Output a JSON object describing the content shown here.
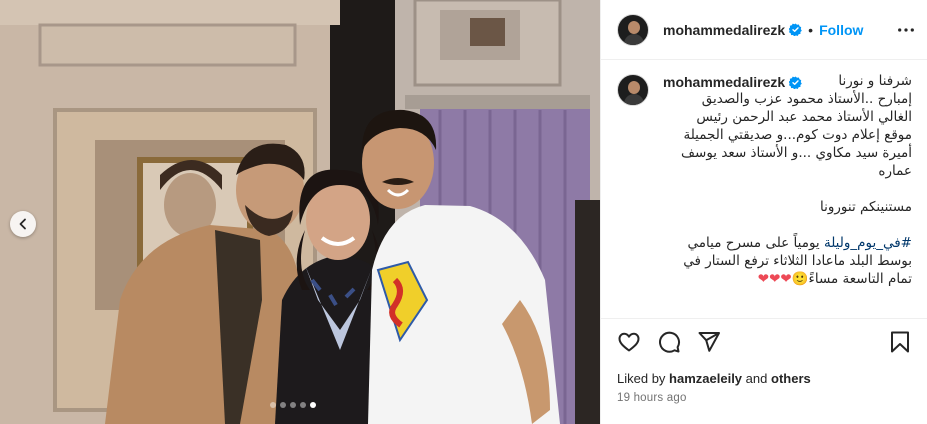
{
  "post": {
    "username": "mohammedalirezk",
    "follow_label": "Follow",
    "separator": "•",
    "carousel": {
      "dot_count": 5,
      "active_index": 4
    }
  },
  "caption": {
    "username": "mohammedalirezk",
    "lines": [
      "شرفنا و نورنا",
      "إمبارح ..الأستاذ محمود عزب والصديق",
      "الغالي الأستاذ محمد عبد الرحمن رئيس",
      "موقع إعلام دوت كوم...و صديقتي الجميلة",
      "أميرة سيد مكاوي ...و الأستاذ سعد يوسف",
      "عماره"
    ],
    "line2": "مستنينكم تنورونا",
    "hashtag": "#في_يوم_وليلة",
    "line3a": " يومياً على مسرح ميامي",
    "line3b": "بوسط البلد ماعادا الثلاثاء ترفع الستار في",
    "line3c": "تمام التاسعة مساءً",
    "emoji": "🙂",
    "hearts": "❤❤❤"
  },
  "likes": {
    "prefix": "Liked by",
    "user": "hamzaeleily",
    "conj": "and",
    "others": "others"
  },
  "timestamp": "19 hours ago",
  "icons": [
    "verified-icon",
    "more-options-icon",
    "like-heart-icon",
    "comment-icon",
    "share-icon",
    "save-bookmark-icon",
    "chevron-left-icon"
  ],
  "colors": {
    "link": "#0095f6",
    "hashtag": "#00376b",
    "heart": "#ed4956",
    "muted": "#737373"
  }
}
